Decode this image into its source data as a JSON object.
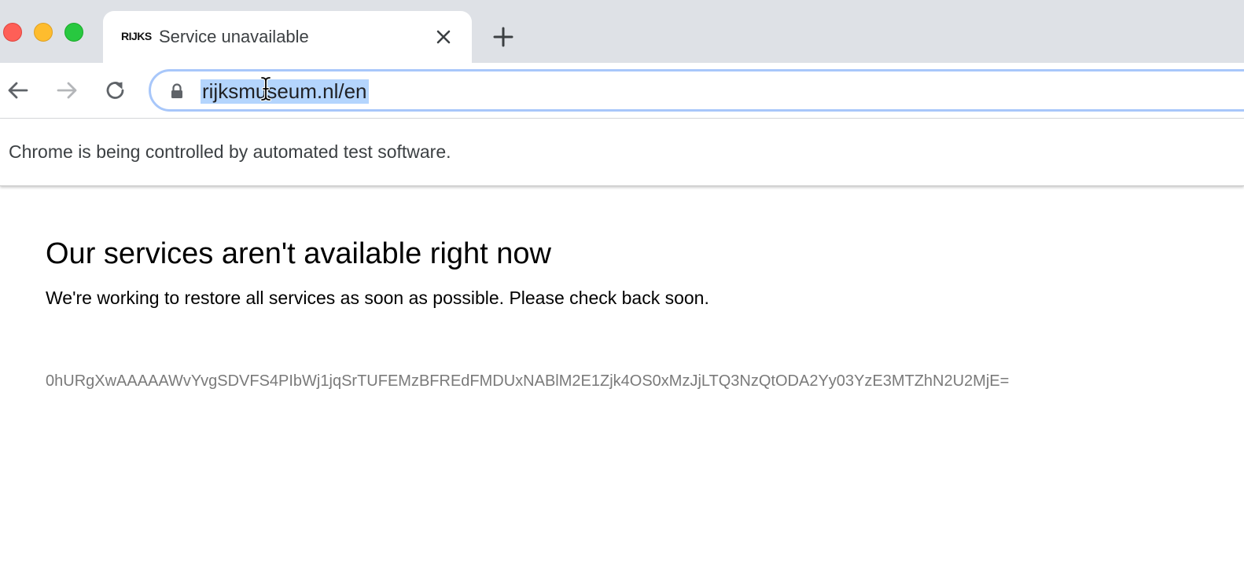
{
  "window": {
    "controls": [
      "close",
      "minimize",
      "maximize"
    ],
    "colors": {
      "close": "#fe5f57",
      "minimize": "#febc2e",
      "maximize": "#28c840"
    }
  },
  "tab": {
    "favicon_text": "RIJKS",
    "title": "Service unavailable",
    "close_icon": "close-icon"
  },
  "new_tab_icon": "plus-icon",
  "toolbar": {
    "back_icon": "arrow-left-icon",
    "forward_icon": "arrow-right-icon",
    "reload_icon": "reload-icon"
  },
  "omnibox": {
    "lock_icon": "lock-icon",
    "url": "rijksmuseum.nl/en",
    "selection_color": "#b4d5fd",
    "focus_ring_color": "#a8c7fa"
  },
  "infobar": {
    "text": "Chrome is being controlled by automated test software."
  },
  "page": {
    "heading": "Our services aren't available right now",
    "message": "We're working to restore all services as soon as possible. Please check back soon.",
    "reference_id": "0hURgXwAAAAAWvYvgSDVFS4PIbWj1jqSrTUFEMzBFREdFMDUxNABlM2E1Zjk4OS0xMzJjLTQ3NzQtODA2Yy03YzE3MTZhN2U2MjE="
  }
}
